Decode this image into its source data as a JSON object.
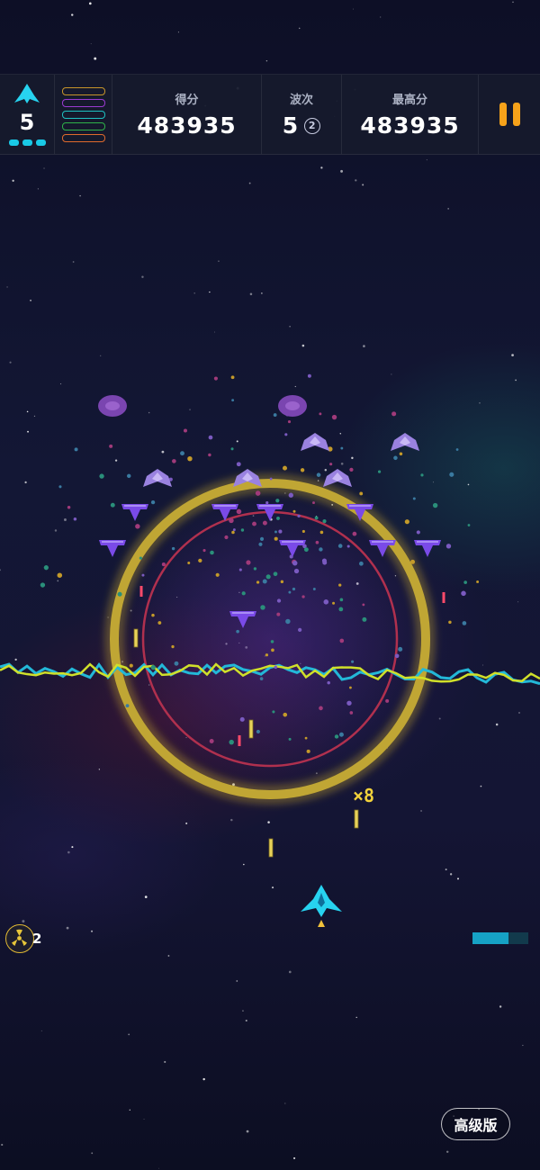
{
  "hud": {
    "lives": "5",
    "lives_pips": 3,
    "powerup_colors": [
      "#c8952a",
      "#9a3ad1",
      "#1ec2c2",
      "#2fb24a",
      "#e06a2c"
    ],
    "score_label": "得分",
    "score": "483935",
    "wave_label": "波次",
    "wave": "5",
    "wave_sub": "2",
    "best_label": "最高分",
    "best": "483935",
    "pause_icon": "pause-icon",
    "accent_color": "#f6a21a"
  },
  "game": {
    "multiplier": "×8",
    "bomb_count": "2",
    "energy_level": 0.65,
    "enemy_color": "#8a5cf0",
    "player_color": "#27d3f0"
  },
  "premium_button": "高级版"
}
